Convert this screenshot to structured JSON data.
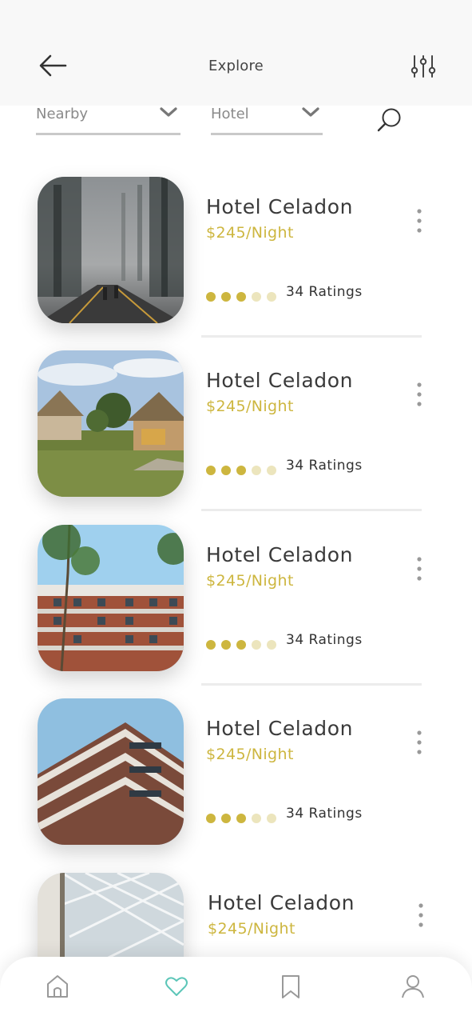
{
  "header": {
    "title": "Explore",
    "back_icon": "arrow-left-icon",
    "filter_icon": "sliders-icon"
  },
  "filters": {
    "location": "Nearby",
    "type": "Hotel",
    "search_icon": "search-icon"
  },
  "colors": {
    "accent": "#cdb63f",
    "accent_light": "#ece5bd",
    "nav_active": "#5cc6b8"
  },
  "hotels": [
    {
      "name": "Hotel Celadon",
      "price": "$245/Night",
      "rating": 3,
      "rating_max": 5,
      "ratings_text": "34 Ratings",
      "image": "foggy-forest-road"
    },
    {
      "name": "Hotel Celadon",
      "price": "$245/Night",
      "rating": 3,
      "rating_max": 5,
      "ratings_text": "34 Ratings",
      "image": "thatched-huts"
    },
    {
      "name": "Hotel Celadon",
      "price": "$245/Night",
      "rating": 3,
      "rating_max": 5,
      "ratings_text": "34 Ratings",
      "image": "apartment-block-trees"
    },
    {
      "name": "Hotel Celadon",
      "price": "$245/Night",
      "rating": 3,
      "rating_max": 5,
      "ratings_text": "34 Ratings",
      "image": "modern-balconies"
    },
    {
      "name": "Hotel Celadon",
      "price": "$245/Night",
      "image": "glass-roof-atrium"
    }
  ],
  "bottom_nav": [
    {
      "icon": "home-icon",
      "active": false
    },
    {
      "icon": "heart-icon",
      "active": true
    },
    {
      "icon": "bookmark-icon",
      "active": false
    },
    {
      "icon": "user-icon",
      "active": false
    }
  ]
}
